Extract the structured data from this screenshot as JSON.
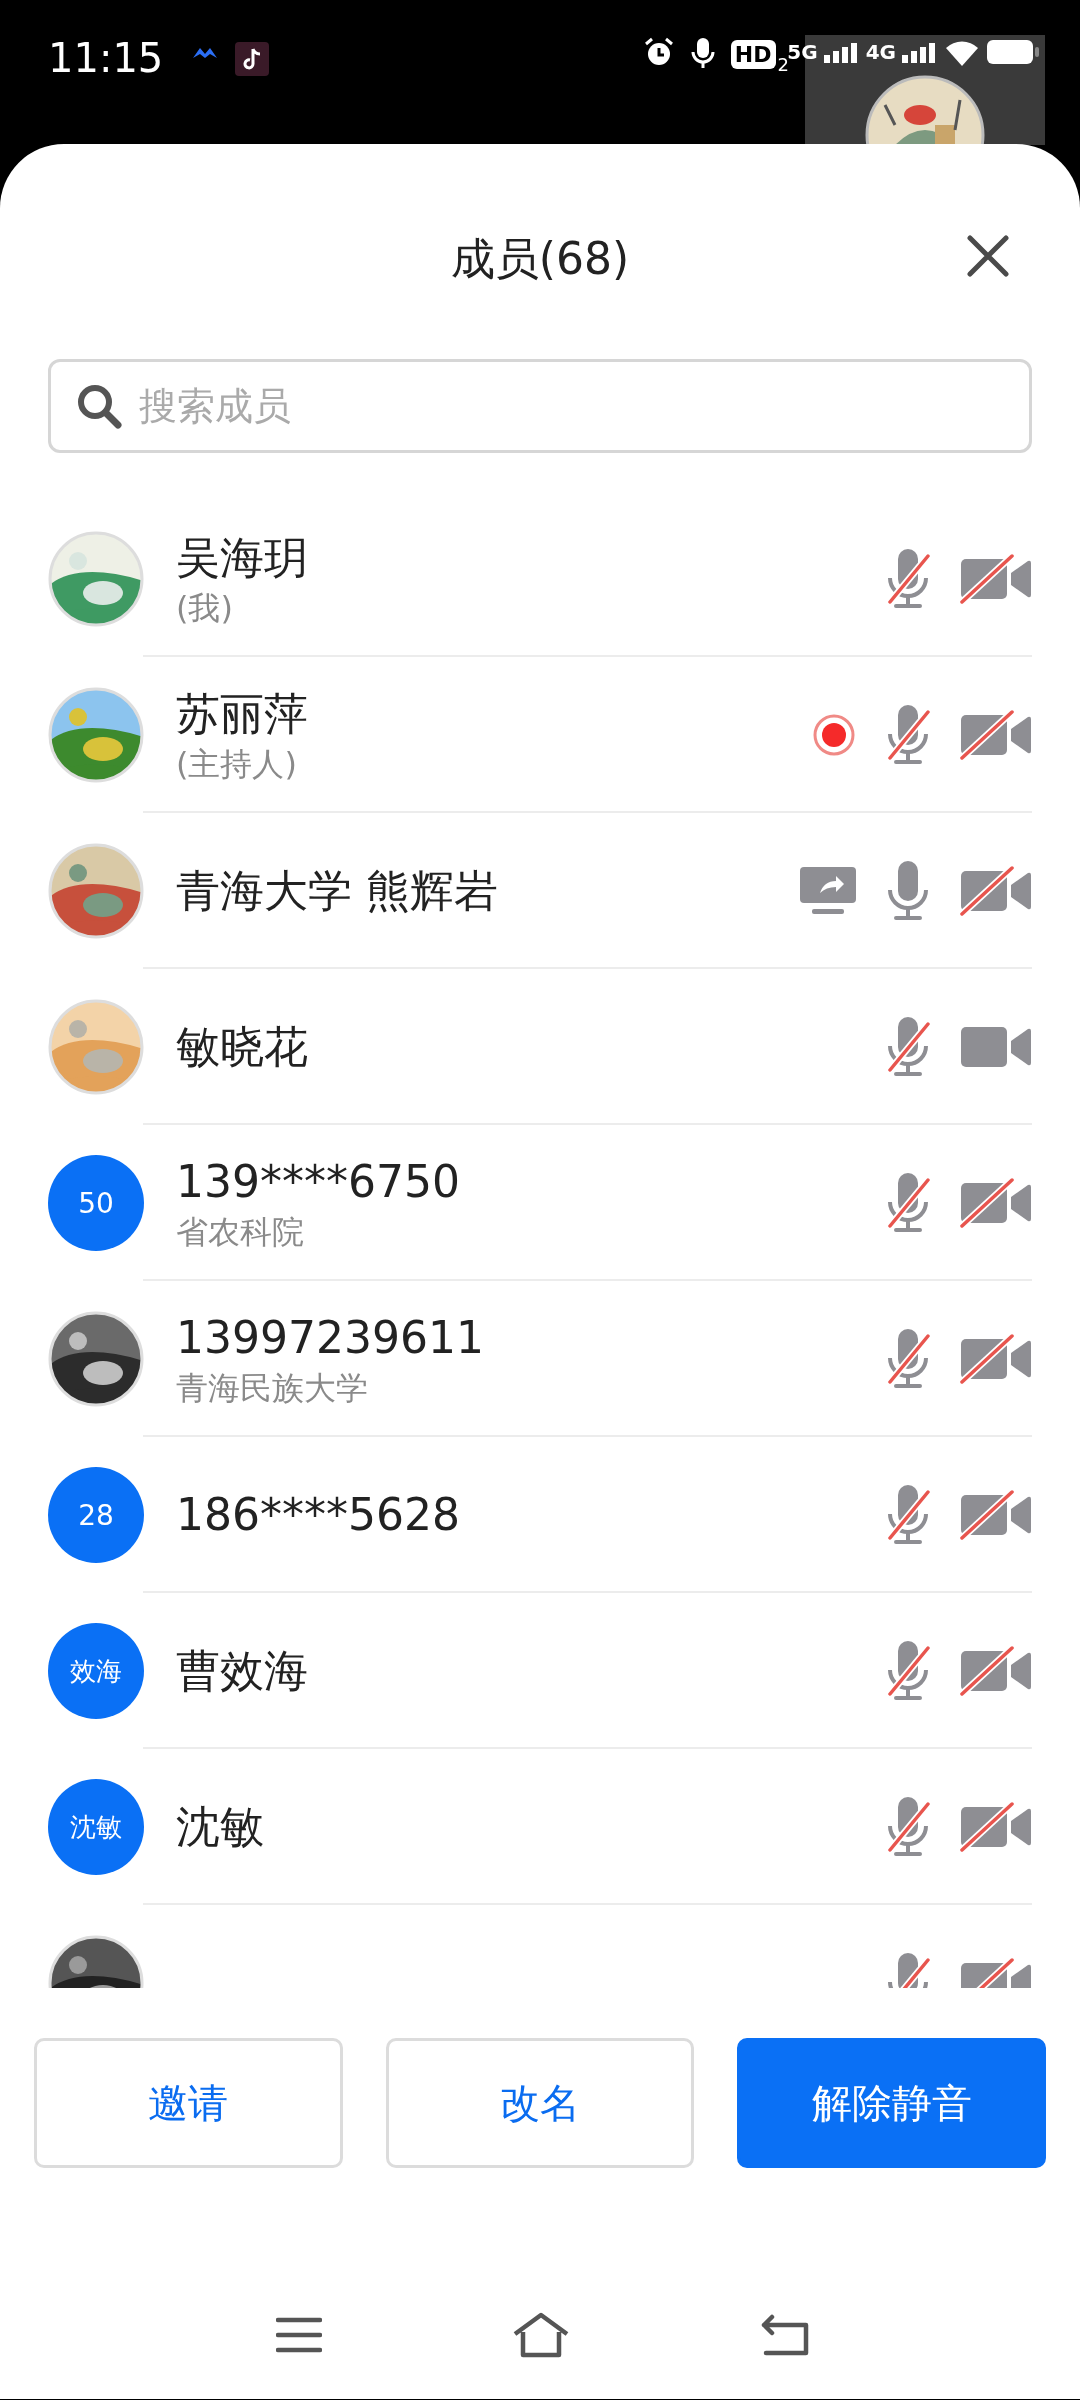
{
  "status_bar": {
    "time": "11:15",
    "hd": "HD",
    "hd_sub": "2",
    "network_1": "5G",
    "network_2": "4G"
  },
  "sheet": {
    "title": "成员(68)"
  },
  "search": {
    "placeholder": "搜索成员"
  },
  "members": [
    {
      "name": "吴海玥",
      "subtitle": "(我)",
      "recording": false,
      "sharing": false,
      "mic_muted": true,
      "camera_off": true
    },
    {
      "name": "苏丽萍",
      "subtitle": "(主持人)",
      "recording": true,
      "sharing": false,
      "mic_muted": true,
      "camera_off": true
    },
    {
      "name": "青海大学 熊辉岩",
      "recording": false,
      "sharing": true,
      "mic_muted": false,
      "camera_off": true
    },
    {
      "name": "敏晓花",
      "recording": false,
      "sharing": false,
      "mic_muted": true,
      "camera_off": false
    },
    {
      "name": "139****6750",
      "subtitle": "省农科院",
      "avatar": {
        "kind": "initials",
        "text": "50"
      },
      "recording": false,
      "sharing": false,
      "mic_muted": true,
      "camera_off": true
    },
    {
      "name": "13997239611",
      "subtitle": "青海民族大学",
      "recording": false,
      "sharing": false,
      "mic_muted": true,
      "camera_off": true
    },
    {
      "name": "186****5628",
      "avatar": {
        "kind": "initials",
        "text": "28"
      },
      "recording": false,
      "sharing": false,
      "mic_muted": true,
      "camera_off": true
    },
    {
      "name": "曹效海",
      "avatar": {
        "kind": "initials",
        "text": "效海"
      },
      "recording": false,
      "sharing": false,
      "mic_muted": true,
      "camera_off": true
    },
    {
      "name": "沈敏",
      "avatar": {
        "kind": "initials",
        "text": "沈敏"
      },
      "recording": false,
      "sharing": false,
      "mic_muted": true,
      "camera_off": true
    },
    {
      "recording": false,
      "sharing": false,
      "mic_muted": true,
      "camera_off": true
    }
  ],
  "buttons": [
    {
      "label": "邀请",
      "primary": false
    },
    {
      "label": "改名",
      "primary": false
    },
    {
      "label": "解除静音",
      "primary": true
    }
  ]
}
